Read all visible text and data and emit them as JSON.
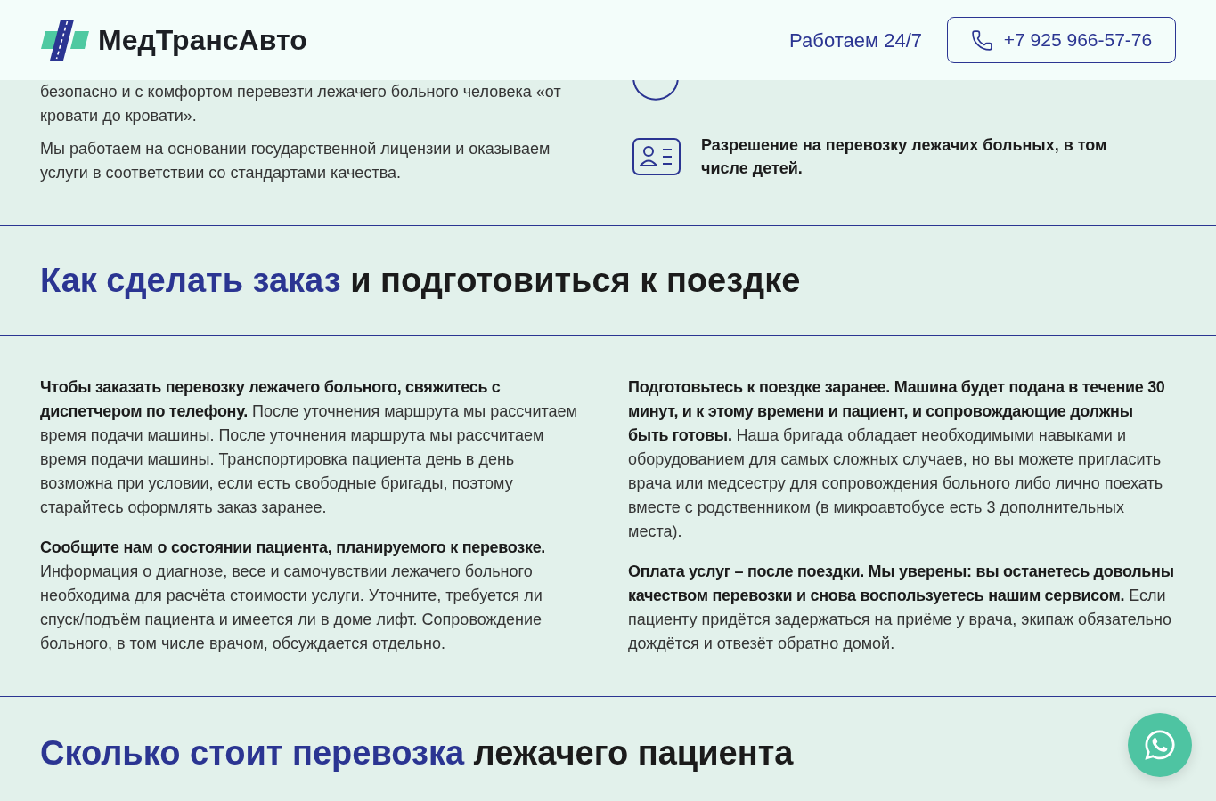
{
  "header": {
    "logo_text": "МедТрансАвто",
    "hours": "Работаем 24/7",
    "phone_button": "+7 925 966-57-76"
  },
  "intro": {
    "paragraphs": [
      "безопасно и с комфортом перевезти лежачего больного человека «от кровати до кровати».",
      "Мы работаем на основании государственной лицензии и оказываем услуги в соответствии со стандартами качества."
    ],
    "features": [
      {
        "text": "Разрешение на перевозку лежачих больных, в том числе детей."
      }
    ]
  },
  "order_section": {
    "title_highlight": "Как сделать заказ",
    "title_rest": "и подготовиться к поездке",
    "columns": [
      [
        "**Чтобы заказать перевозку лежачего больного, свяжитесь с диспетчером по телефону.** После уточнения маршрута мы рассчитаем время подачи машины. После уточнения маршрута мы рассчитаем время подачи машины. Транспортировка пациента день в день возможна при условии, если есть свободные бригады, поэтому старайтесь оформлять заказ заранее.",
        "**Сообщите нам о состоянии пациента, планируемого к перевозке.** Информация о диагнозе, весе и самочувствии лежачего больного необходима для расчёта стоимости услуги. Уточните, требуется ли спуск/подъём пациента и имеется ли в доме лифт. Сопровождение больного, в том числе врачом, обсуждается отдельно."
      ],
      [
        "**Подготовьтесь к поездке заранее. Машина будет подана в течение 30 минут, и к этому времени и пациент, и сопровождающие должны быть готовы.** Наша бригада обладает необходимыми навыками и оборудованием для самых сложных случаев, но вы можете пригласить врача или медсестру для сопровождения больного либо лично поехать вместе с родственником (в микроавтобусе есть 3 дополнительных места).",
        "**Оплата услуг – после поездки. Мы уверены: вы останетесь довольны качеством перевозки и снова воспользуетесь нашим сервисом.** Если пациенту придётся задержаться на приёме у врача, экипаж обязательно дождётся и отвезёт обратно домой."
      ]
    ]
  },
  "price_section": {
    "title_highlight": "Сколько стоит перевозка",
    "title_rest": "лежачего пациента"
  }
}
